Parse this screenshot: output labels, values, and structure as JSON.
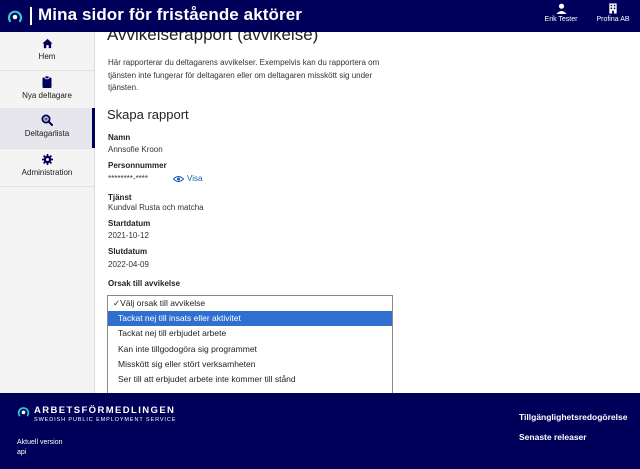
{
  "header": {
    "title": "Mina sidor för fristående aktörer",
    "user_name": "Erik Tester",
    "org_name": "Profina AB"
  },
  "sidebar": {
    "items": [
      {
        "label": "Hem",
        "icon": "home-icon"
      },
      {
        "label": "Nya deltagare",
        "icon": "clipboard-icon"
      },
      {
        "label": "Deltagarlista",
        "icon": "search-list-icon",
        "active": true
      },
      {
        "label": "Administration",
        "icon": "gear-icon"
      }
    ]
  },
  "main": {
    "page_title": "Avvikelserapport (avvikelse)",
    "intro": "Här rapporterar du deltagarens avvikelser. Exempelvis kan du rapportera om tjänsten inte fungerar för deltagaren eller om deltagaren misskött sig under tjänsten.",
    "section_title": "Skapa rapport",
    "fields": {
      "name_label": "Namn",
      "name_value": "Annsofie Kroon",
      "pnr_label": "Personnummer",
      "pnr_value": "********-****",
      "visa_label": "Visa",
      "service_label": "Tjänst",
      "service_value": "Kundval Rusta och matcha",
      "start_label": "Startdatum",
      "start_value": "2021-10-12",
      "end_label": "Slutdatum",
      "end_value": "2022-04-09",
      "reason_label": "Orsak till avvikelse"
    },
    "reason_options": [
      "✓Välj orsak till avvikelse",
      "Tackat nej till insats eller aktivitet",
      "Tackat nej till erbjudet arbete",
      "Kan inte tillgodogöra sig programmet",
      "Misskött sig eller stört verksamheten",
      "Ser till att erbjudet arbete inte kommer till stånd"
    ],
    "highlighted_option_index": 1
  },
  "footer": {
    "brand_name": "ARBETSFÖRMEDLINGEN",
    "brand_sub": "SWEDISH PUBLIC EMPLOYMENT SERVICE",
    "version_label": "Aktuell version",
    "version_value": "api",
    "link_accessibility": "Tillgänglighetsredogörelse",
    "link_releases": "Senaste releaser"
  },
  "colors": {
    "brand_navy": "#00005a",
    "highlight": "#2f6fd0",
    "link": "#1a5fb4"
  }
}
